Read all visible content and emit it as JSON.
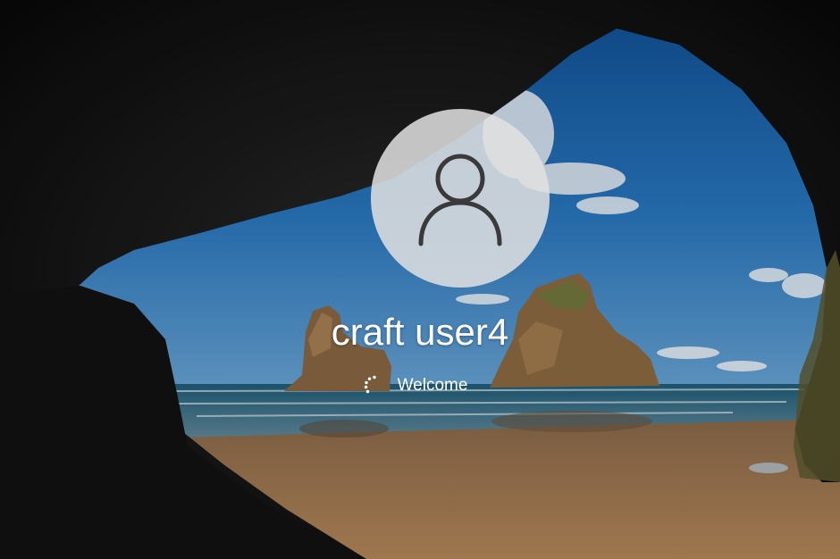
{
  "login": {
    "username": "craft user4",
    "status": "Welcome"
  },
  "icons": {
    "avatar": "user-silhouette-icon",
    "loading": "spinner-icon"
  },
  "colors": {
    "avatar_circle": "#e1e1e1",
    "text": "#ffffff",
    "sky": "#2a78c0",
    "sand": "#a87a4e",
    "cave": "#0d0d0d"
  }
}
